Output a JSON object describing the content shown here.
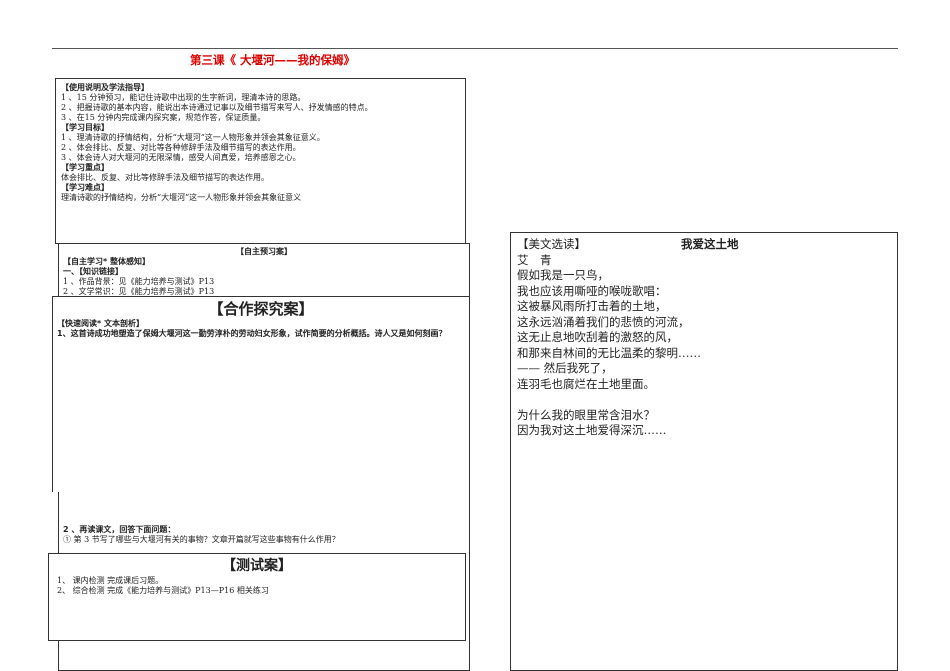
{
  "title": "第三课《 大堰河——我的保姆》",
  "guide": {
    "heading": "【使用说明及学法指导】",
    "items": [
      "1 、15 分钟预习，能记住诗歌中出现的生字新词，理清本诗的思路。",
      "2 、把握诗歌的基本内容，能说出本诗通过记事以及细节描写来写人、抒发情感的特点。",
      "3 、在15 分钟内完成课内探究案，规范作答，保证质量。"
    ],
    "goals_heading": "【学习目标】",
    "goals": [
      "1 、理清诗歌的抒情结构，分析“大堰河”这一人物形象并领会其象征意义。",
      "2 、体会排比、反复、对比等各种修辞手法及细节描写的表达作用。",
      "3 、体会诗人对大堰河的无限深情，感受人间真爱，培养感恩之心。"
    ],
    "key_heading": "【学习重点】",
    "key": "体会排比、反复、对比等修辞手法及细节描写的表达作用。",
    "difficult_heading": "【学习难点】",
    "difficult": "理清诗歌的抒情结构，分析“大堰河”这一人物形象并领会其象征意义"
  },
  "preview": {
    "heading": "【自主预习案】",
    "sub": "【自主学习* 整体感知】",
    "link": "一、【知识链接】",
    "items": [
      "1 、作品背景：见《能力培养与测试》P13",
      "2 、文学常识：见《能力培养与测试》P13"
    ]
  },
  "coop": {
    "heading": "【合作探究案】",
    "sub": "【快速阅读* 文本剖析】",
    "q1": "1、这首诗成功地塑造了保姆大堰河这一勤劳淳朴的劳动妇女形象，试作简要的分析概括。诗人又是如何刻画？",
    "q2": "2 、再读课文，回答下面问题：",
    "q2_1": "① 第 3 节写了哪些与大堰河有关的事物？文章开篇就写这些事物有什么作用？"
  },
  "test": {
    "heading": "【测试案】",
    "items": [
      "1、 课内检测   完成课后习题。",
      "2、 综合检测   完成《能力培养与测试》P13—P16 相关练习"
    ]
  },
  "reading": {
    "label": "【美文选读】",
    "title": "我爱这土地",
    "author": "艾　青",
    "lines": [
      "假如我是一只鸟，",
      "我也应该用嘶哑的喉咙歌唱：",
      "这被暴风雨所打击着的土地，",
      "这永远汹涌着我们的悲愤的河流，",
      "这无止息地吹刮着的激怒的风，",
      "和那来自林间的无比温柔的黎明……",
      "—— 然后我死了，",
      "连羽毛也腐烂在土地里面。",
      "",
      "为什么我的眼里常含泪水？",
      "因为我对这土地爱得深沉……"
    ]
  }
}
